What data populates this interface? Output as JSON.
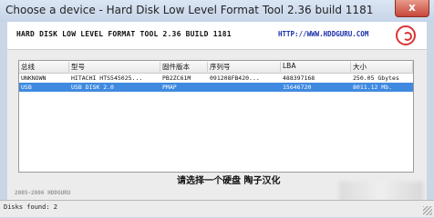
{
  "window": {
    "title": "Choose a device - Hard Disk Low Level Format Tool 2.36 build 1181",
    "close_glyph": "x"
  },
  "header": {
    "app_title": "HARD DISK LOW LEVEL FORMAT TOOL 2.36 BUILD 1181",
    "url": "HTTP://WWW.HDDGURU.COM",
    "logo_icon": "hddguru-logo-icon"
  },
  "table": {
    "columns": [
      "总线",
      "型号",
      "固件版本",
      "序列号",
      "LBA",
      "大小"
    ],
    "rows": [
      [
        "UNKNOWN",
        "HITACHI HTS545025...",
        "PB2ZC61M",
        "091208FB420...",
        "488397168",
        "250.05 Gbytes"
      ],
      [
        "USB",
        "USB DISK 2.0",
        "PMAP",
        "",
        "15646720",
        "8011.12 Mb."
      ]
    ],
    "selected_row": 1,
    "selection_color": "#3f8ae0"
  },
  "footer": {
    "copyright": "2005-2006 HDDGURU",
    "prompt": "请选择一个硬盘    陶子汉化"
  },
  "status": {
    "text": "Disks found: 2"
  }
}
